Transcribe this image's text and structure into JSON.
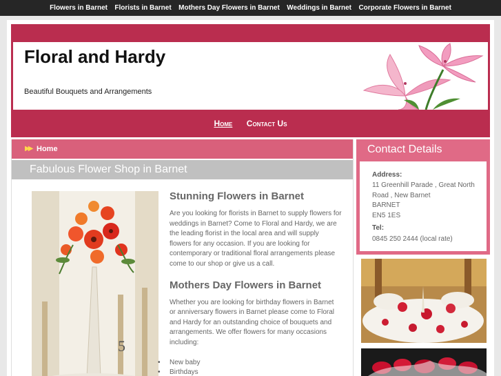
{
  "topnav": {
    "items": [
      {
        "label": "Flowers in Barnet"
      },
      {
        "label": "Florists in Barnet"
      },
      {
        "label": "Mothers Day Flowers in Barnet"
      },
      {
        "label": "Weddings in Barnet"
      },
      {
        "label": "Corporate Flowers in Barnet"
      }
    ]
  },
  "header": {
    "title": "Floral and Hardy",
    "tagline": "Beautiful Bouquets and Arrangements"
  },
  "mainnav": {
    "home": "Home",
    "contact": "Contact Us"
  },
  "breadcrumb": {
    "arrows": "▶▶",
    "label": "Home"
  },
  "main": {
    "page_title": "Fabulous Flower Shop in Barnet",
    "section1_heading": "Stunning Flowers in Barnet",
    "section1_text": "Are you looking for florists in Barnet to supply flowers for weddings in Barnet? Come to Floral and Hardy, we are the leading florist in the local area and will supply flowers for any occasion. If you are looking for contemporary or traditional floral arrangements please come to our shop or give us a call.",
    "section2_heading": "Mothers Day Flowers in Barnet",
    "section2_text": "Whether you are looking for birthday flowers in Barnet or anniversary flowers in Barnet please come to Floral and Hardy for an outstanding choice of bouquets and arrangements. We offer flowers for many occasions including:",
    "occasions": [
      "New baby",
      "Birthdays"
    ],
    "table_number": "5"
  },
  "contact": {
    "title": "Contact Details",
    "address_label": "Address:",
    "address_line1": "11 Greenhill Parade , Great North Road , New Barnet",
    "address_city": "BARNET",
    "address_postcode": "EN5 1ES",
    "tel_label": "Tel:",
    "tel_value": "0845 250 2444 (local rate)"
  },
  "colors": {
    "brand": "#ba2d4f",
    "accent_pink": "#e06a86",
    "breadcrumb_pink": "#d9607b",
    "title_bar_grey": "#c0c0c0",
    "topnav_bg": "#262626",
    "text_grey": "#666666"
  }
}
